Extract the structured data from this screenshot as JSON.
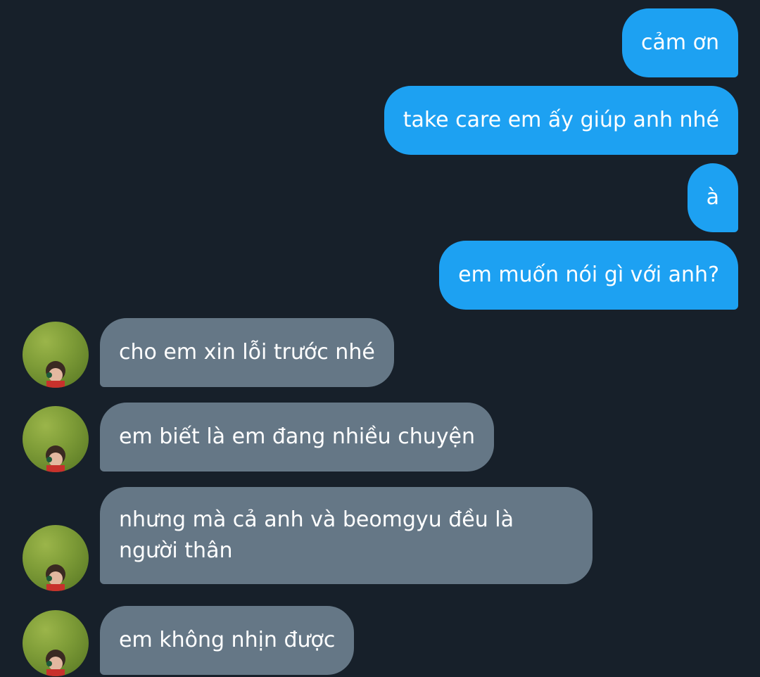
{
  "conversation": {
    "messages": [
      {
        "direction": "outgoing",
        "text": "cảm ơn"
      },
      {
        "direction": "outgoing",
        "text": "take care em ấy giúp anh nhé"
      },
      {
        "direction": "outgoing",
        "text": "à"
      },
      {
        "direction": "outgoing",
        "text": "em muốn nói gì với anh?"
      },
      {
        "direction": "incoming",
        "text": "cho em xin lỗi trước nhé"
      },
      {
        "direction": "incoming",
        "text": "em biết là em đang nhiều chuyện"
      },
      {
        "direction": "incoming",
        "text": "nhưng mà cả anh và beomgyu đều là người thân"
      },
      {
        "direction": "incoming",
        "text": "em không nhịn được"
      }
    ]
  },
  "colors": {
    "background": "#17202a",
    "outgoing_bubble": "#1da1f2",
    "incoming_bubble": "#657786",
    "text": "#ffffff"
  }
}
